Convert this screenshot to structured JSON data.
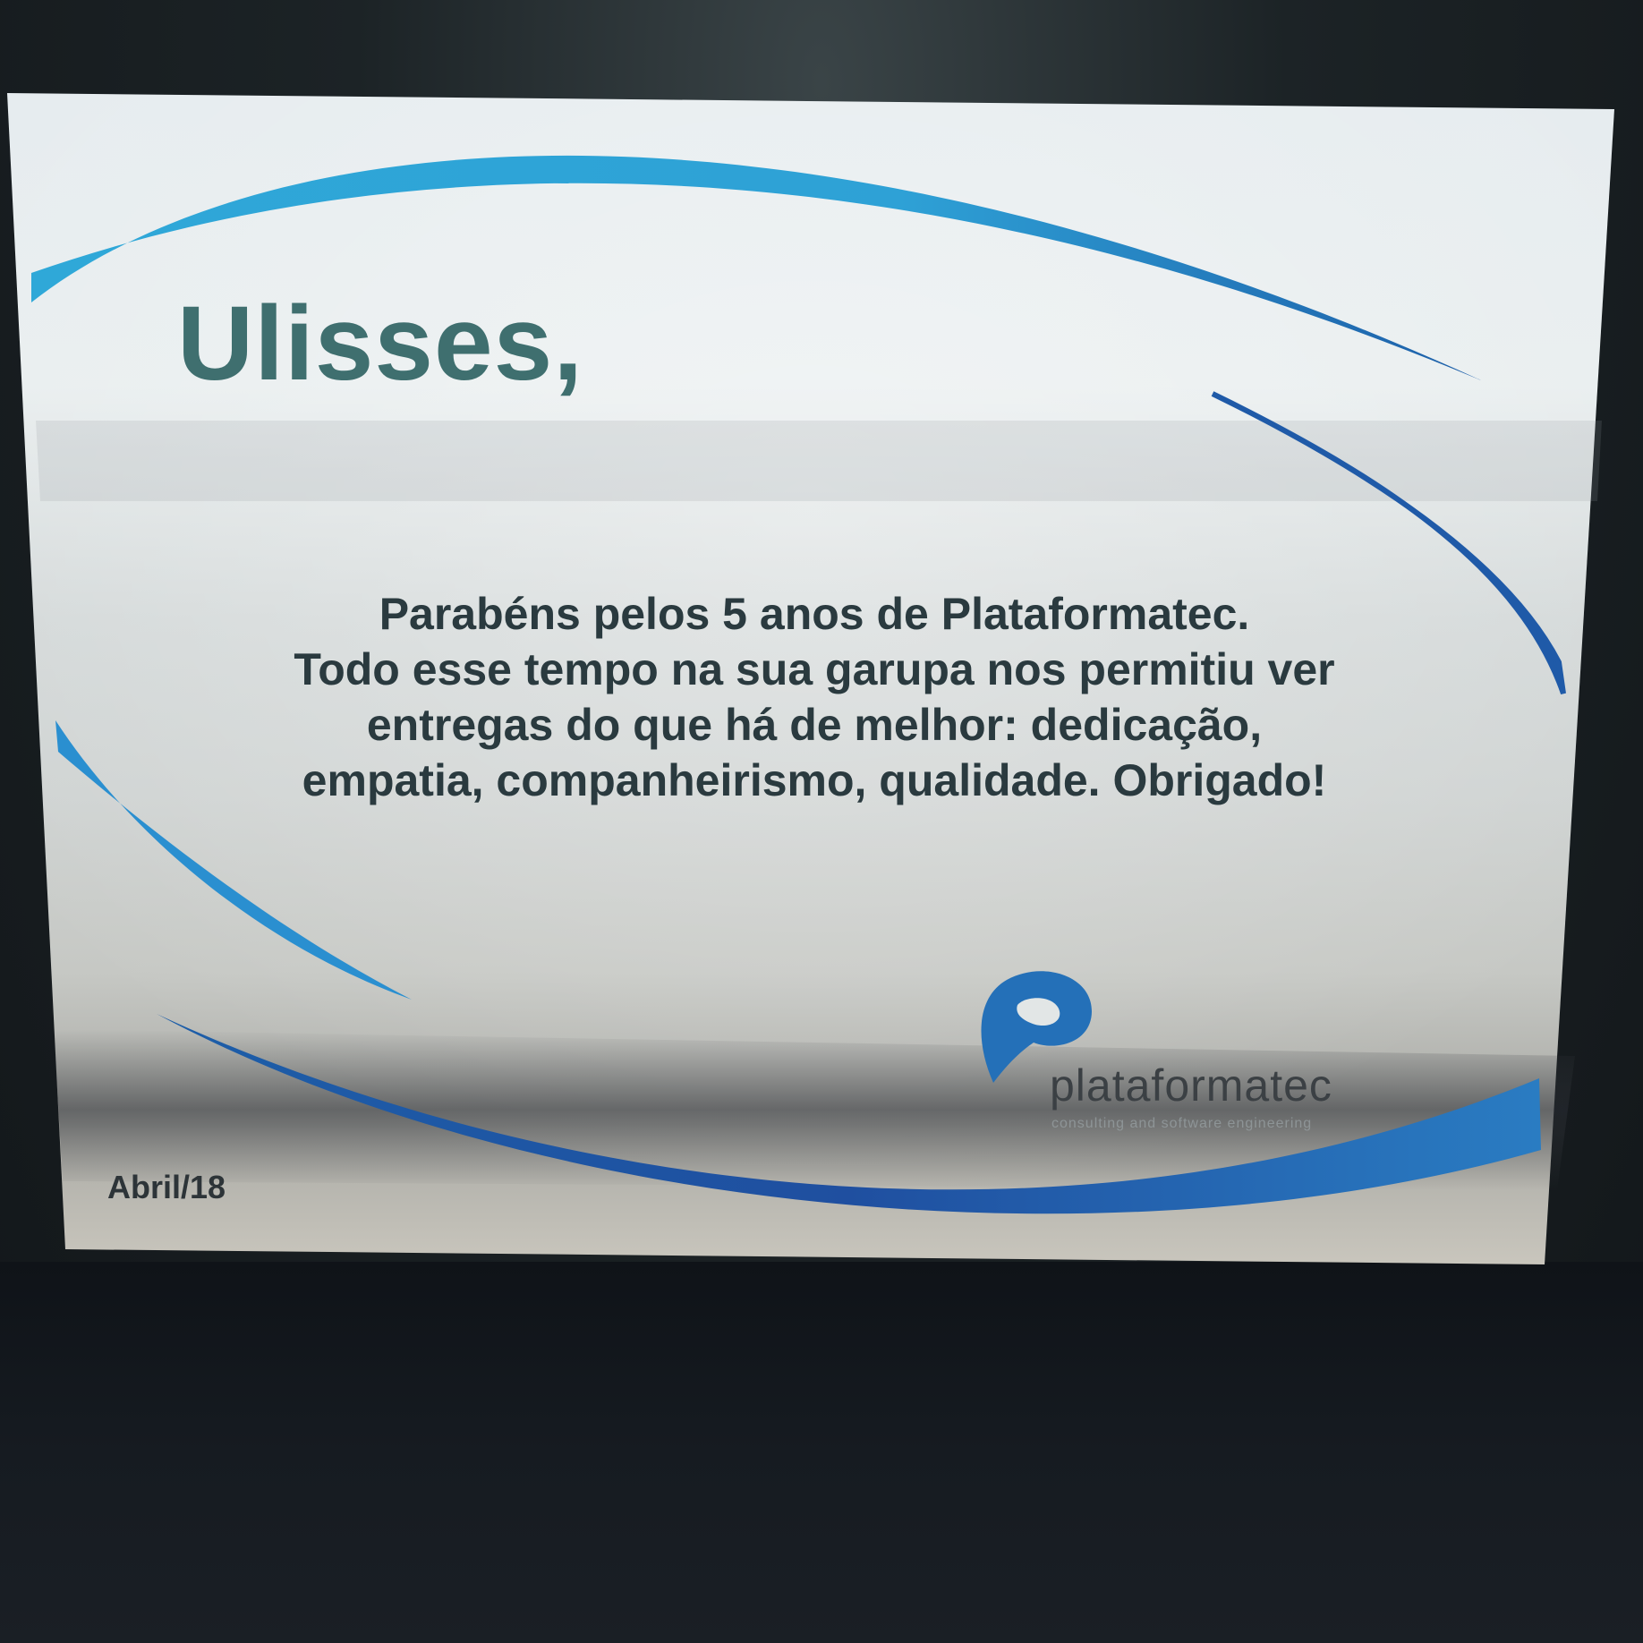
{
  "plaque": {
    "name": "Ulisses,",
    "message_lines": [
      "Parabéns pelos 5 anos de Plataformatec.",
      "Todo esse tempo na sua garupa nos permitiu ver",
      "entregas do que há de melhor: dedicação,",
      "empatia, companheirismo, qualidade. Obrigado!"
    ],
    "date": "Abril/18"
  },
  "logo": {
    "wordmark": "plataformatec",
    "tagline": "consulting and software engineering",
    "icon": "plataformatec-p-icon"
  },
  "colors": {
    "swoosh_light": "#2fa8d8",
    "swoosh_dark": "#1d5ea8",
    "name_text": "#3f6f6f",
    "body_text": "#2a3a3f",
    "logo_blue": "#2470b8"
  }
}
